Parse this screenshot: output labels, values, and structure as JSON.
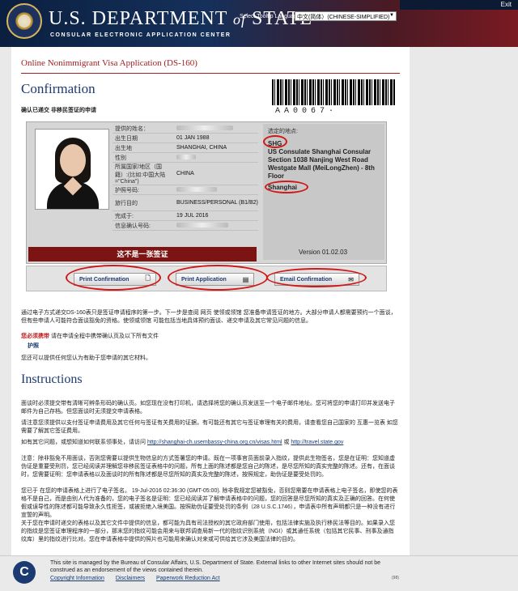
{
  "header": {
    "title_main": "U.S. DEPARTMENT",
    "title_of": "of",
    "title_end": "STATE",
    "subtitle": "CONSULAR ELECTRONIC APPLICATION CENTER",
    "exit": "Exit",
    "lang_label": "Select Tooltip Language",
    "lang_value": "中文(简体）(CHINESE-SIMPLIFIED)"
  },
  "page": {
    "form_title": "Online Nonimmigrant Visa Application (DS-160)",
    "heading": "Confirmation",
    "subheading": "确认已递交 非移民签证的申请",
    "barcode_text": "AA0067·"
  },
  "applicant": {
    "fields": [
      {
        "label": "提供的姓名：",
        "value": ""
      },
      {
        "label": "出生日期",
        "value": "01 JAN 1988"
      },
      {
        "label": "出生地",
        "value": "SHANGHAI, CHINA"
      },
      {
        "label": "性别",
        "value": ""
      },
      {
        "label": "所属国家/地区（国籍）:(比如:中国大陆=\"China\")",
        "value": "CHINA"
      },
      {
        "label": "护照号码:",
        "value": ""
      },
      {
        "label": "旅行目的",
        "value": "BUSINESS/PERSONAL (B1/B2)"
      },
      {
        "label": "完成于:",
        "value": "19 JUL 2016"
      },
      {
        "label": "信息确认号码:",
        "value": ""
      }
    ],
    "not_visa_banner": "这不是一张签证"
  },
  "location": {
    "label": "选定的地点:",
    "code": "SHG",
    "address": "US Consulate Shanghai Consular Section 1038 Nanjing West Road Westgate Mall (MeiLongZhen) - 8th Floor",
    "city": "Shanghai",
    "version": "Version 01.02.03"
  },
  "actions": {
    "print_confirmation": "Print Confirmation",
    "print_application": "Print Application",
    "email_confirmation": "Email Confirmation"
  },
  "body": {
    "intro": "通过电子方式递交DS-160表只是签证申请程序的第一步。下一步是查阅 网页 使领或领馆 您准备申请签证的地方。大部分申请人都需要预约一个面谈，但有些申请人可能符合面谈豁免的资格。使领或领馆 可能包括当地具体预约面谈、递交申请及其它常见问题的信息。",
    "warn_label": "您必须携带",
    "warn_text": "请在申请全程中携带确认页及以下所有文件",
    "passport": "护照",
    "other_docs": "您还可以提供任何您认为有助于您申请的其它材料。",
    "instructions_heading": "Instructions",
    "instr1": "面谈时必须提交带有清晰可辨条形码的确认页。如您现在没有打印机，请选择将您的确认页发送至一个电子邮件地址。您可将您的申请打印并发送电子邮件为自己存档。但您面谈时无须提交申请表格。",
    "instr2": "请注意您须提供以支付签证申请费用及其它任何与签证有关费用的证据，有可能还有其它与签证审理有关的费用，请查看您自己国家的 互惠一览表 如您需要了解其它签证费用。",
    "instr3_prefix": "如有其它问题，或想知道如何联系领事处，请访问",
    "instr3_link1": "http://shanghai-ch.usembassy-china.org.cn/visas.html",
    "instr3_or": "或",
    "instr3_link2": "http://travel.state.gov",
    "instr4": "注意：除非豁免不用面谈，否则您需要以提供生物信息的方式签署您的申请。既在一项事官员面前录入指纹，提供此生物签名，您是在证明：您知道虚伪证是重要受刑罚，您已经阅读并理解您非移民签证表格中的问题，所有上面的陈述都是您自己的陈述，是尽您所知的真实完整的陈述。还有，在面谈时，您需要证明：您申请表格以及面谈时的所有陈述都是尽您所知的真实及完整的陈述，按照规定，助伪证是要受处罚的。",
    "instr5": "您已于 在您的申请表格上进行了电子签名。 19-Jul-2016 02:36:30 (GMT-05:00). 除非我规定您被豁免，否则您需要在申请表格上电子签名，即使您的表格不是自己，而是由别人代为准备的，您的电子签名是证明：您已经阅读并了解申请表格中的问题，您的回答是尽您所知的真实及正确的回答。在何使假或误导性的陈述都可能导致永久性拒签，或被拒绝入境美国。按照助伪证要受处罚的条例（28 U.S.C.1746），申请表中所有声明都只是一种没有进行宣誓的声明。",
    "instr6": "关于您在申请时递交的表格以及其它文件中提供的信息，都可能为具有司法授权的其它政府部门使用，包括法律实施及执行移民法等目的。如果录入您的指纹是您签证审理程序的一部分，那末您的指纹可能会用来与联邦调查局新一代的指纹识别系统（NGI）或其通任系统（包括其它民事、刑事及通指纹库）里的指纹进行比对。您在申请表格中提供的照片也可能用来确认对来或可供给其它涉及美国法律的目的。"
  },
  "footer": {
    "logo_letter": "C",
    "text": "This site is managed by the Bureau of Consular Affairs, U.S. Department of State. External links to other Internet sites should not be construed as an endorsement of the views contained therein.",
    "link1": "Copyright Information",
    "link2": "Disclaimers",
    "link3": "Paperwork Reduction Act",
    "num": "(98)"
  }
}
